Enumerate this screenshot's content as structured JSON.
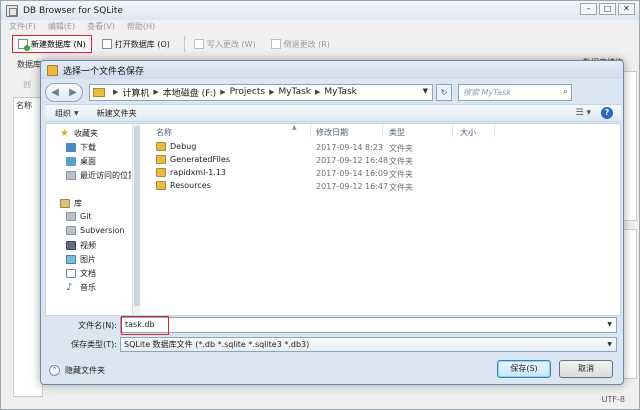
{
  "app": {
    "title": "DB Browser for SQLite",
    "menu": [
      "文件(F)",
      "编辑(E)",
      "查看(V)",
      "帮助(H)"
    ],
    "toolbar": {
      "new_db": "新建数据库 (N)",
      "open_db": "打开数据库 (O)",
      "write_changes": "写入更改 (W)",
      "revert_changes": "倒退更改 (R)"
    },
    "left_frag": {
      "tab": "数据库",
      "create": "创",
      "col": "名称"
    },
    "right_frag": {
      "panel": "数据库结构"
    },
    "status_encoding": "UTF-8"
  },
  "dialog": {
    "title": "选择一个文件名保存",
    "breadcrumb": [
      "计算机",
      "本地磁盘 (F:)",
      "Projects",
      "MyTask",
      "MyTask"
    ],
    "search_placeholder": "搜索 MyTask",
    "organize": "组织",
    "new_folder": "新建文件夹",
    "nav": {
      "favorites": "收藏夹",
      "favorites_items": [
        "下载",
        "桌面",
        "最近访问的位置"
      ],
      "libraries": "库",
      "libraries_items": [
        "Git",
        "Subversion",
        "视频",
        "图片",
        "文档",
        "音乐"
      ]
    },
    "columns": {
      "name": "名称",
      "date": "修改日期",
      "type": "类型",
      "size": "大小"
    },
    "files": [
      {
        "name": "Debug",
        "date": "2017-09-14 8:23",
        "type": "文件夹"
      },
      {
        "name": "GeneratedFiles",
        "date": "2017-09-12 16:48",
        "type": "文件夹"
      },
      {
        "name": "rapidxml-1.13",
        "date": "2017-09-14 16:09",
        "type": "文件夹"
      },
      {
        "name": "Resources",
        "date": "2017-09-12 16:47",
        "type": "文件夹"
      }
    ],
    "filename_label": "文件名(N):",
    "filename_value": "task.db",
    "filetype_label": "保存类型(T):",
    "filetype_value": "SQLite 数据库文件 (*.db *.sqlite *.sqlite3 *.db3)",
    "hide_folders": "隐藏文件夹",
    "save": "保存(S)",
    "cancel": "取消"
  }
}
